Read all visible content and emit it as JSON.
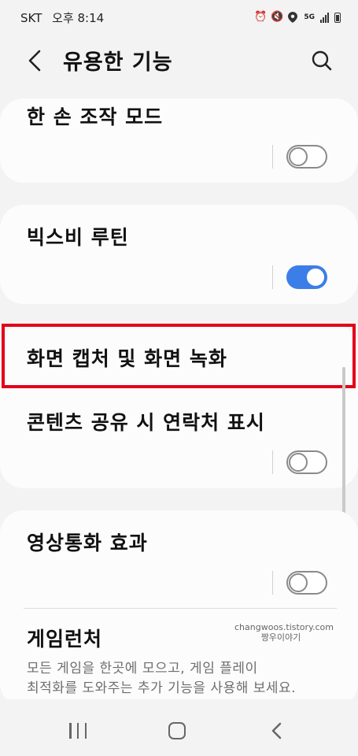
{
  "status_bar": {
    "carrier": "SKT",
    "time": "오후 8:14",
    "network": "5G"
  },
  "header": {
    "title": "유용한 기능"
  },
  "settings": [
    {
      "label": "한 손 조작 모드",
      "toggle": "off"
    },
    {
      "label": "빅스비 루틴",
      "toggle": "on"
    },
    {
      "label": "화면 캡처 및 화면 녹화",
      "highlighted": true
    },
    {
      "label": "콘텐츠 공유 시 연락처 표시",
      "toggle": "off"
    },
    {
      "label": "영상통화 효과",
      "toggle": "off"
    },
    {
      "label": "게임런처",
      "description_line1": "모든 게임을 한곳에 모으고, 게임 플레이",
      "description_line2": "최적화를 도와주는 추가 기능을 사용해 보세요."
    }
  ],
  "watermark": {
    "line1": "changwoos.tistory.com",
    "line2": "짱우이야기"
  },
  "colors": {
    "toggle_on": "#3c7ee8",
    "highlight_border": "#e2001a"
  }
}
